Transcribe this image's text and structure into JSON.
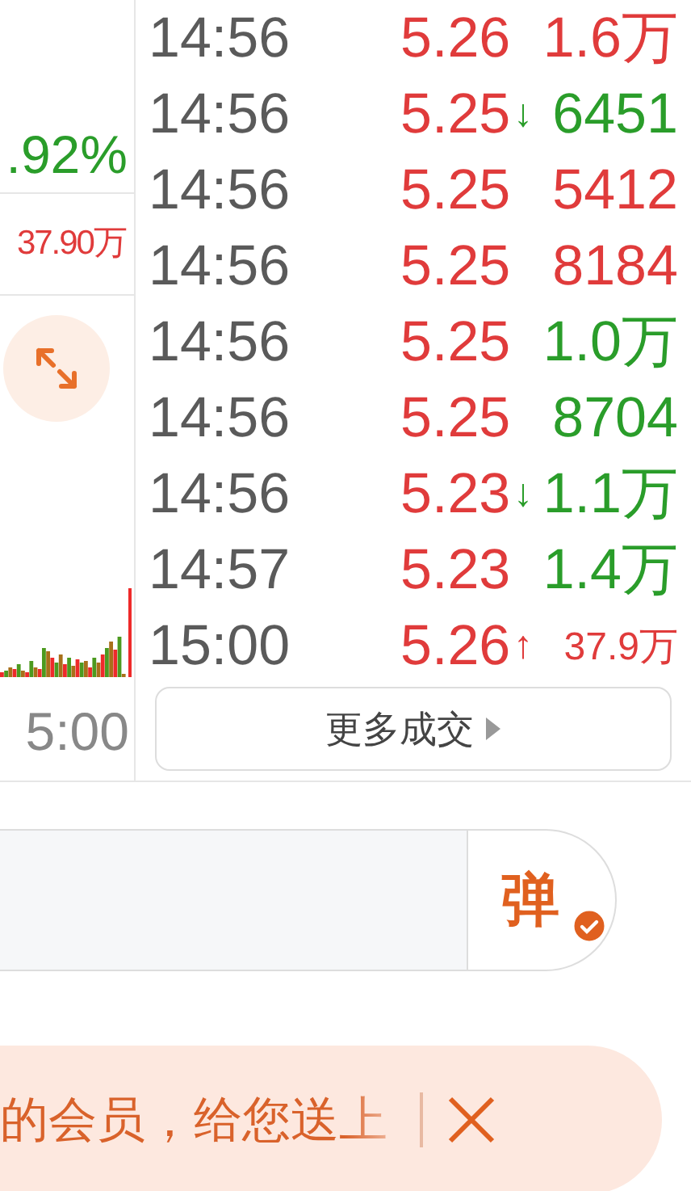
{
  "left_panel": {
    "change_percent": ".92%",
    "amount": "37.90万",
    "time_label": "5:00"
  },
  "trades": [
    {
      "time": "14:56",
      "price": "5.26",
      "volume": "1.6万",
      "color": "#e03b3b"
    },
    {
      "time": "14:56",
      "price": "5.25",
      "arrow": "↓",
      "volume": "6451",
      "color": "#2a9d2a"
    },
    {
      "time": "14:56",
      "price": "5.25",
      "volume": "5412",
      "color": "#e03b3b"
    },
    {
      "time": "14:56",
      "price": "5.25",
      "volume": "8184",
      "color": "#e03b3b"
    },
    {
      "time": "14:56",
      "price": "5.25",
      "volume": "1.0万",
      "color": "#2a9d2a"
    },
    {
      "time": "14:56",
      "price": "5.25",
      "volume": "8704",
      "color": "#2a9d2a"
    },
    {
      "time": "14:56",
      "price": "5.23",
      "arrow": "↓",
      "volume": "1.1万",
      "color": "#2a9d2a"
    },
    {
      "time": "14:57",
      "price": "5.23",
      "volume": "1.4万",
      "color": "#2a9d2a"
    },
    {
      "time": "15:00",
      "price": "5.26",
      "arrow": "↑",
      "volume": "37.9万",
      "color": "#e03b3b"
    }
  ],
  "more_button": "更多成交",
  "comment_bar": {
    "danmaku_button": "弹",
    "danmaku_on": true
  },
  "promo_banner": {
    "text": "的会员，给您送上"
  }
}
